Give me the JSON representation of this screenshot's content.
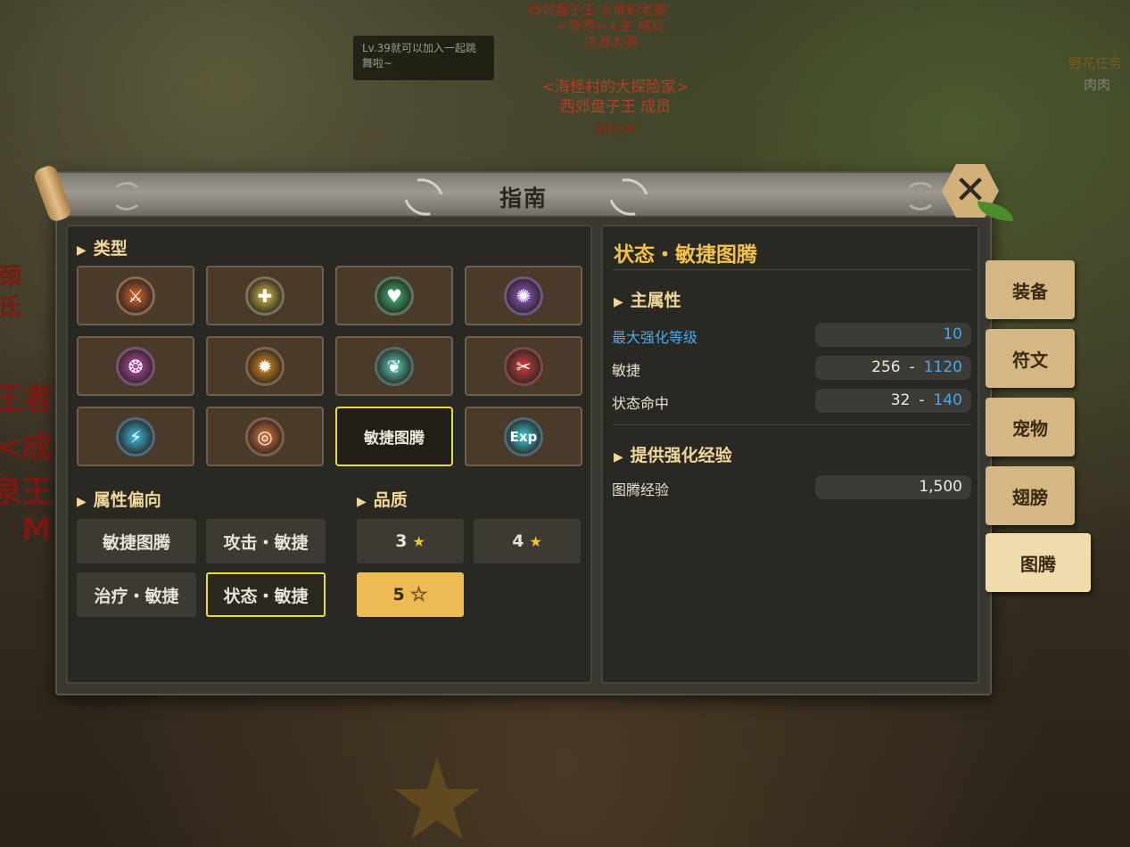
{
  "background": {
    "guild_lines": [
      "西郊盘子王·太郎的老婆",
      "<新秀>人生 成员",
      "决战太湖"
    ],
    "bubble_text": "Lv.39就可以加入一起跳舞啦~",
    "guild2_lines": [
      "<海怪村的大探险家>",
      "西郊盘子王 成员",
      "atree"
    ],
    "right_tag": "野花任务",
    "right_name": "肉肉",
    "left_bits": [
      "颈",
      "氐",
      "王者",
      "<成",
      "泉王",
      "M"
    ]
  },
  "window": {
    "title": "指南",
    "close_icon": "close-x-icon"
  },
  "left": {
    "type_header": "类型",
    "types": [
      {
        "icon": "sword-icon",
        "glyph": "⚔",
        "color": "#e0642c",
        "ring": "#8a6a4a"
      },
      {
        "icon": "shield-icon",
        "glyph": "✚",
        "color": "#d8c04a",
        "ring": "#7a7358"
      },
      {
        "icon": "heart-plus-icon",
        "glyph": "♥",
        "color": "#3ac27a",
        "ring": "#5a7a5a"
      },
      {
        "icon": "spiral-gem-icon",
        "glyph": "✺",
        "color": "#9c54d8",
        "ring": "#6c5a84"
      },
      {
        "icon": "triple-gem-icon",
        "glyph": "❂",
        "color": "#c84ab8",
        "ring": "#7a5274"
      },
      {
        "icon": "burst-icon",
        "glyph": "✹",
        "color": "#e8901c",
        "ring": "#806448"
      },
      {
        "icon": "feather-icon",
        "glyph": "❦",
        "color": "#5ad8c0",
        "ring": "#4f7068"
      },
      {
        "icon": "crossed-blade-icon",
        "glyph": "✂",
        "color": "#d83c3c",
        "ring": "#804848"
      },
      {
        "icon": "wing-blade-icon",
        "glyph": "⚡",
        "color": "#3cc0e8",
        "ring": "#4e6c80"
      },
      {
        "icon": "target-icon",
        "glyph": "◎",
        "color": "#e8783c",
        "ring": "#80604c"
      },
      {
        "label": "敏捷图腾",
        "selected": true
      },
      {
        "icon": "exp-icon",
        "glyph": "Exp",
        "color": "#3ad0e0",
        "ring": "#4e6a78"
      }
    ],
    "attr_header": "属性偏向",
    "attr_buttons": [
      "敏捷图腾",
      "攻击・敏捷",
      "治疗・敏捷",
      "状态・敏捷"
    ],
    "attr_selected": 3,
    "quality_header": "品质",
    "quality_buttons": [
      "3",
      "4",
      "5"
    ],
    "quality_selected": 2
  },
  "right": {
    "title": "状态・敏捷图腾",
    "main_header": "主属性",
    "stats": [
      {
        "label": "最大强化等级",
        "base": "",
        "max": "10",
        "label_blue": true
      },
      {
        "label": "敏捷",
        "base": "256",
        "max": "1120",
        "label_blue": false
      },
      {
        "label": "状态命中",
        "base": "32",
        "max": "140",
        "label_blue": false
      }
    ],
    "range_sep": "-",
    "exp_header": "提供强化经验",
    "exp_label": "图腾经验",
    "exp_value": "1,500"
  },
  "side_tabs": [
    "装备",
    "符文",
    "宠物",
    "翅膀",
    "图腾"
  ],
  "side_active": 4
}
